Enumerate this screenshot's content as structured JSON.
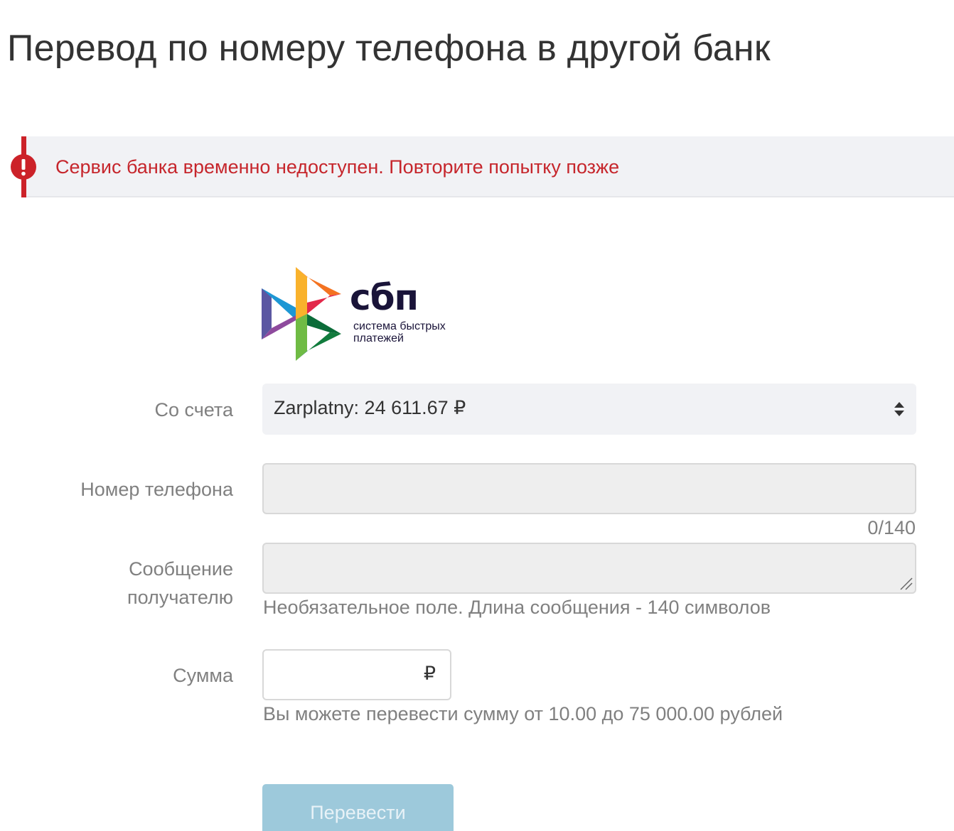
{
  "page": {
    "title": "Перевод по номеру телефона в другой банк"
  },
  "alert": {
    "message": "Сервис банка временно недоступен. Повторите попытку позже",
    "icon": "error-exclamation-icon",
    "color": "#cc2229"
  },
  "logo": {
    "word": "сбп",
    "subtitle_line1": "система быстрых",
    "subtitle_line2": "платежей"
  },
  "form": {
    "account": {
      "label": "Со счета",
      "value": "Zarplatny: 24 611.67 ₽"
    },
    "phone": {
      "label": "Номер телефона",
      "value": ""
    },
    "message": {
      "label_line1": "Сообщение",
      "label_line2": "получателю",
      "value": "",
      "counter": "0/140",
      "hint": "Необязательное поле. Длина сообщения - 140 символов"
    },
    "amount": {
      "label": "Сумма",
      "value": "",
      "currency": "₽",
      "hint": "Вы можете перевести сумму от 10.00 до 75 000.00 рублей"
    },
    "submit_label": "Перевести"
  },
  "colors": {
    "error_text": "#c6262c",
    "button_disabled": "#9dc9db",
    "field_background": "#f1f2f5"
  }
}
